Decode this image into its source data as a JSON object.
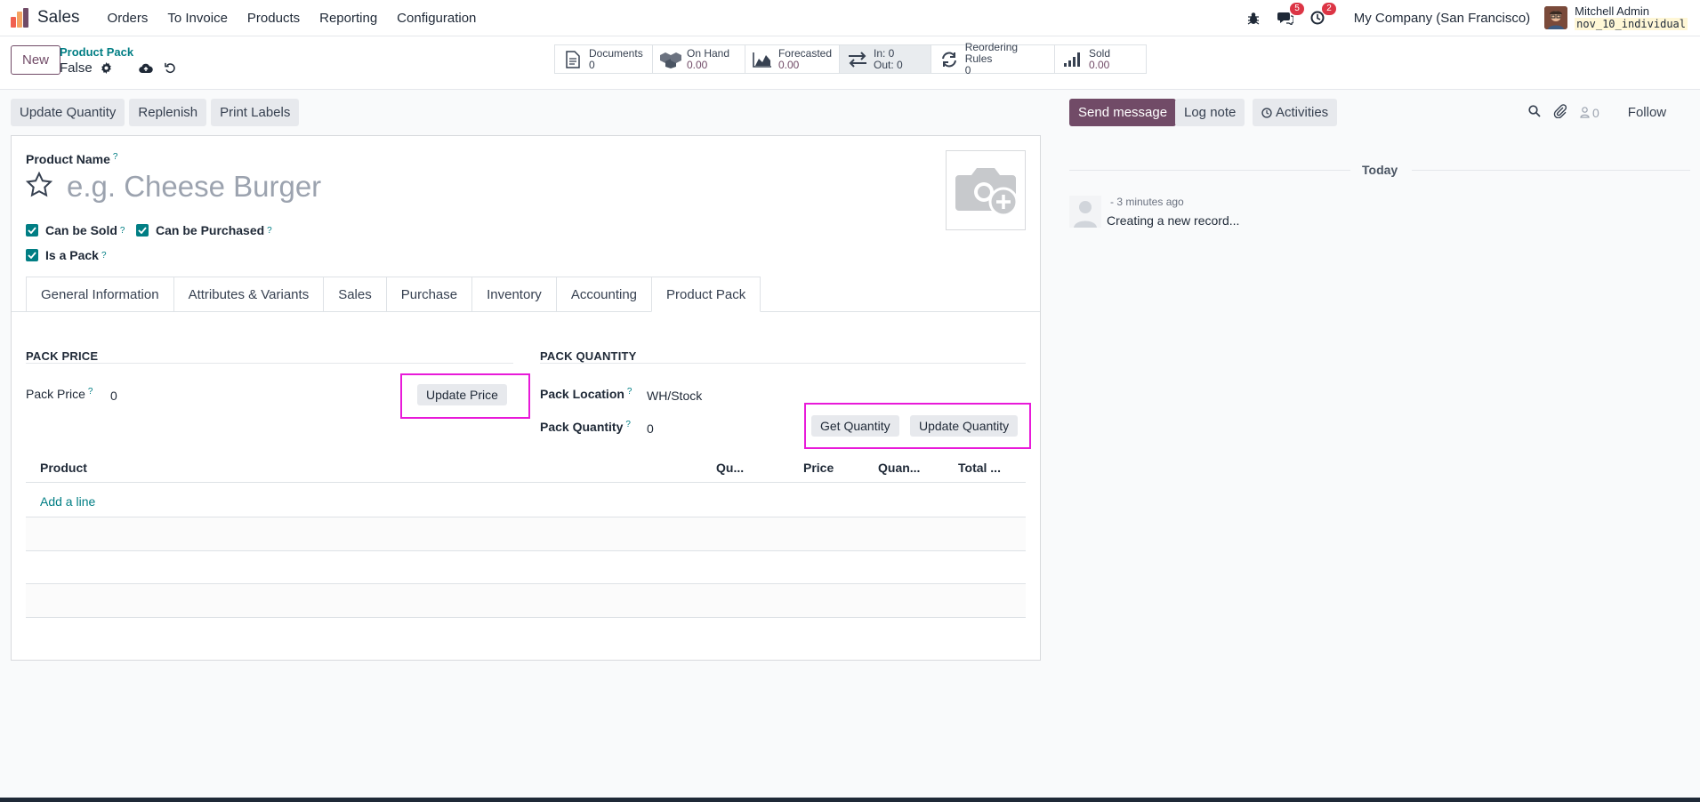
{
  "navbar": {
    "app_name": "Sales",
    "menu": [
      "Orders",
      "To Invoice",
      "Products",
      "Reporting",
      "Configuration"
    ],
    "messages_count": "5",
    "activities_count": "2",
    "company": "My Company (San Francisco)",
    "user_name": "Mitchell Admin",
    "database": "nov_10_individual"
  },
  "control": {
    "new_label": "New",
    "breadcrumb": "Product Pack",
    "record_name": "False",
    "smart_buttons": [
      {
        "label": "Documents",
        "value": "0"
      },
      {
        "label": "On Hand",
        "value": "0.00"
      },
      {
        "label": "Forecasted",
        "value": "0.00"
      },
      {
        "label": "In: 0",
        "value": "Out: 0"
      },
      {
        "label": "Reordering Rules",
        "value": "0"
      },
      {
        "label": "Sold",
        "value": "0.00"
      }
    ]
  },
  "actions": {
    "update_quantity": "Update Quantity",
    "replenish": "Replenish",
    "print_labels": "Print Labels"
  },
  "form": {
    "product_name_label": "Product Name",
    "help_mark": "?",
    "name_placeholder": "e.g. Cheese Burger",
    "can_be_sold": "Can be Sold",
    "can_be_purchased": "Can be Purchased",
    "is_a_pack": "Is a Pack",
    "tabs": [
      "General Information",
      "Attributes & Variants",
      "Sales",
      "Purchase",
      "Inventory",
      "Accounting",
      "Product Pack"
    ],
    "pack_price_title": "PACK PRICE",
    "pack_price_label": "Pack Price",
    "pack_price_value": "0",
    "update_price": "Update Price",
    "pack_quantity_title": "PACK QUANTITY",
    "pack_location_label": "Pack Location",
    "pack_location_value": "WH/Stock",
    "pack_quantity_label": "Pack Quantity",
    "pack_quantity_value": "0",
    "get_quantity": "Get Quantity",
    "update_quantity": "Update Quantity",
    "table_columns": [
      "Product",
      "Qu...",
      "Price",
      "Quan...",
      "Total ..."
    ],
    "add_line": "Add a line"
  },
  "chatter": {
    "send_message": "Send message",
    "log_note": "Log note",
    "activities": "Activities",
    "followers_count": "0",
    "follow": "Follow",
    "today": "Today",
    "message_time": "- 3 minutes ago",
    "message_body": "Creating a new record..."
  },
  "colors": {
    "brand": "#714b67",
    "teal": "#017e84",
    "highlight": "#e81ad9",
    "badge": "#dc3545"
  }
}
